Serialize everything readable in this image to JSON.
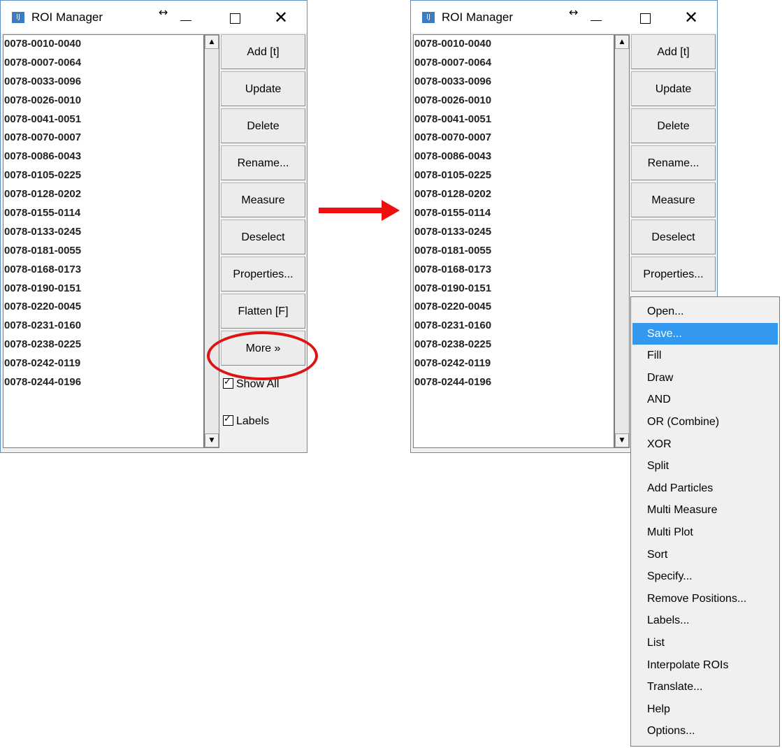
{
  "window": {
    "title": "ROI Manager",
    "icon": "imagej-icon",
    "controls": [
      "resize-icon",
      "minimize-icon",
      "maximize-icon",
      "close-icon"
    ]
  },
  "roi_list": [
    "0078-0010-0040",
    "0078-0007-0064",
    "0078-0033-0096",
    "0078-0026-0010",
    "0078-0041-0051",
    "0078-0070-0007",
    "0078-0086-0043",
    "0078-0105-0225",
    "0078-0128-0202",
    "0078-0155-0114",
    "0078-0133-0245",
    "0078-0181-0055",
    "0078-0168-0173",
    "0078-0190-0151",
    "0078-0220-0045",
    "0078-0231-0160",
    "0078-0238-0225",
    "0078-0242-0119",
    "0078-0244-0196"
  ],
  "buttons": {
    "add": "Add [t]",
    "update": "Update",
    "delete": "Delete",
    "rename": "Rename...",
    "measure": "Measure",
    "deselect": "Deselect",
    "properties": "Properties...",
    "flatten": "Flatten [F]",
    "more": "More »"
  },
  "checkboxes": {
    "show_all": "Show All",
    "show_all_checked": true,
    "labels": "Labels",
    "labels_checked": true
  },
  "more_menu": {
    "items": [
      "Open...",
      "Save...",
      "Fill",
      "Draw",
      "AND",
      "OR (Combine)",
      "XOR",
      "Split",
      "Add Particles",
      "Multi Measure",
      "Multi Plot",
      "Sort",
      "Specify...",
      "Remove Positions...",
      "Labels...",
      "List",
      "Interpolate ROIs",
      "Translate...",
      "Help",
      "Options..."
    ],
    "selected": "Save..."
  },
  "annotation_colors": {
    "highlight": "#e01212",
    "arrow": "#ee1010",
    "menu_selection": "#3399ee"
  }
}
